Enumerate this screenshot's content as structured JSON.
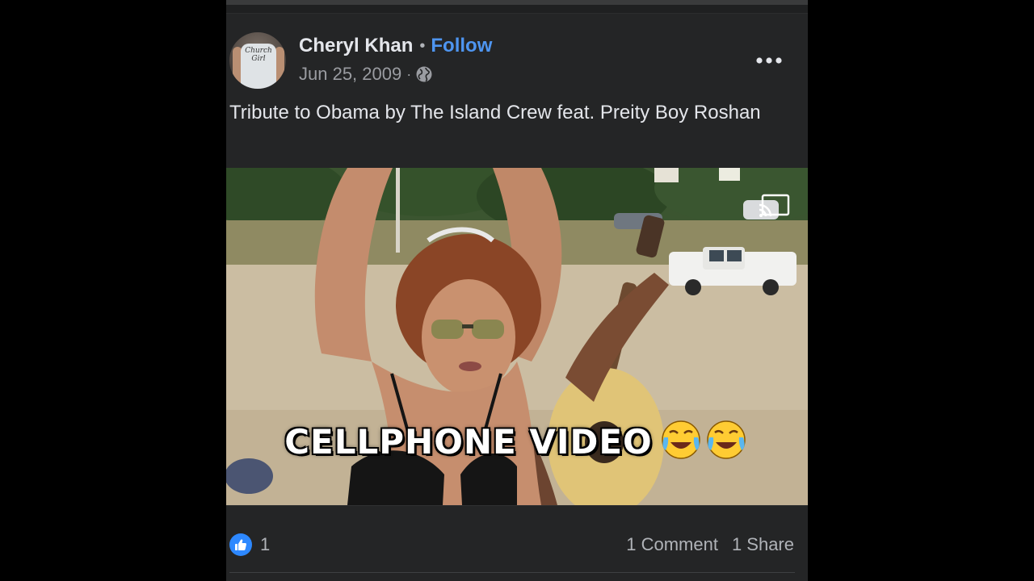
{
  "post": {
    "author": {
      "name": "Cheryl Khan",
      "avatar_shirt_text": "Church Girl"
    },
    "follow_label": "Follow",
    "separator": "•",
    "date": "Jun 25, 2009",
    "meta_separator": "·",
    "privacy_icon": "globe-icon",
    "more_icon": "more-options-icon",
    "caption": "Tribute to Obama by The Island Crew feat. Preity Boy Roshan"
  },
  "video": {
    "overlay_text": "CELLPHONE VIDEO",
    "overlay_emoji": "😂😂",
    "cast_icon": "cast-icon"
  },
  "footer": {
    "reaction_icon": "like-icon",
    "reaction_count": "1",
    "comments_label": "1 Comment",
    "shares_label": "1 Share"
  },
  "colors": {
    "background": "#242526",
    "primary_text": "#e4e6eb",
    "secondary_text": "#b0b3b8",
    "link": "#4e95f0",
    "like_blue": "#2d88ff"
  }
}
